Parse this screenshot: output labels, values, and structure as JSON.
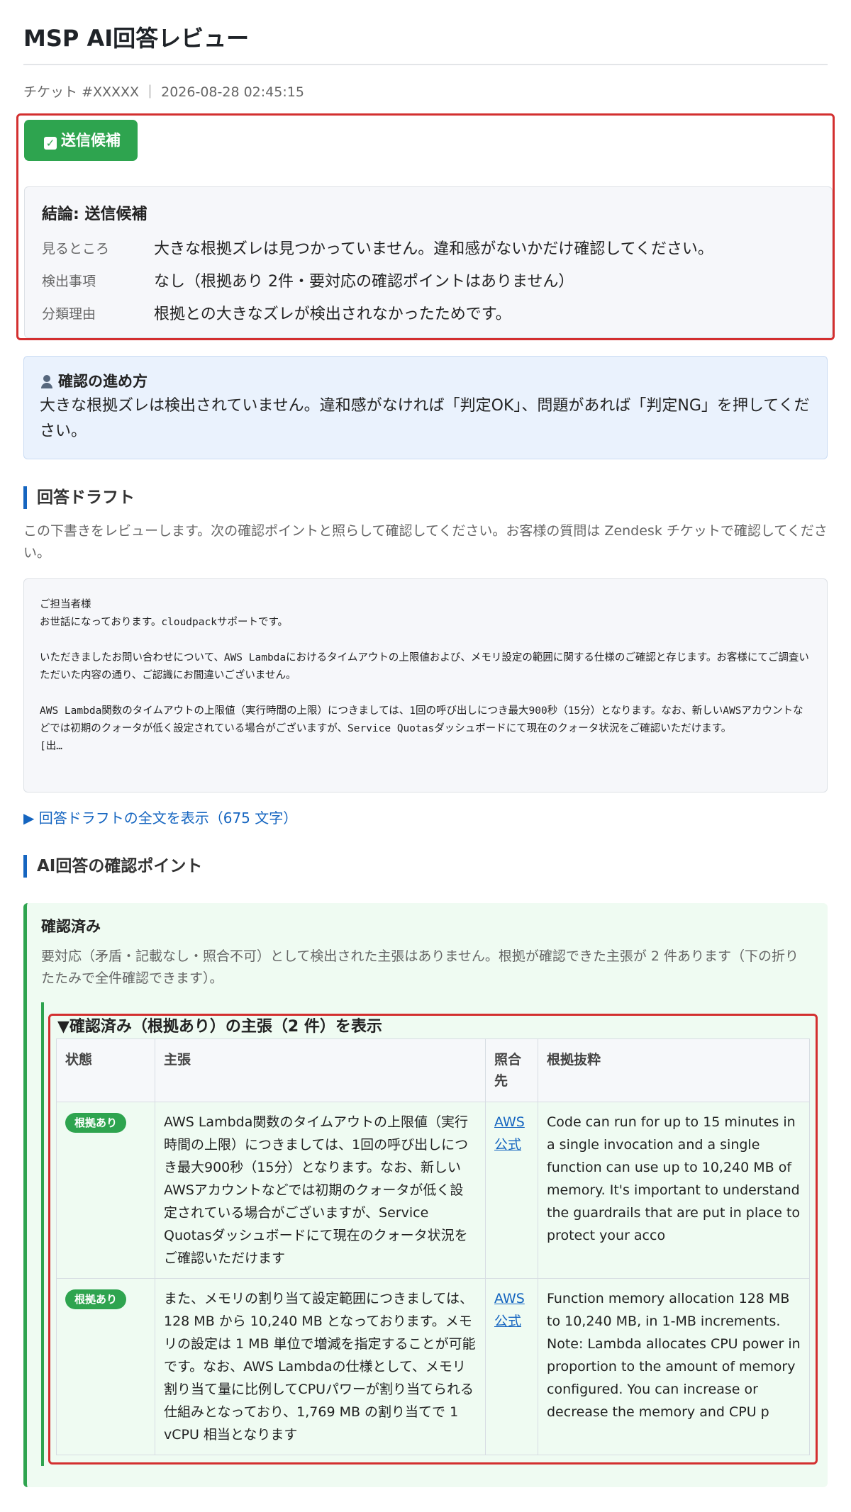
{
  "page": {
    "title": "MSP AI回答レビュー",
    "meta": "チケット #XXXXX ｜ 2026-08-28 02:45:15"
  },
  "verdict": {
    "badge_label": "送信候補",
    "badge_icon": "check-box-icon",
    "conclusion": "結論: 送信候補",
    "rows": [
      {
        "key": "見るところ",
        "value": "大きな根拠ズレは見つかっていません。違和感がないかだけ確認してください。"
      },
      {
        "key": "検出事項",
        "value": "なし（根拠あり 2件・要対応の確認ポイントはありません）"
      },
      {
        "key": "分類理由",
        "value": "根拠との大きなズレが検出されなかったためです。"
      }
    ]
  },
  "guide": {
    "title": "確認の進め方",
    "text": "大きな根拠ズレは検出されていません。違和感がなければ「判定OK」、問題があれば「判定NG」を押してください。"
  },
  "draft": {
    "heading": "回答ドラフト",
    "description": "この下書きをレビューします。次の確認ポイントと照らして確認してください。お客様の質問は Zendesk チケットで確認してください。",
    "body": "ご担当者様\nお世話になっております。cloudpackサポートです。\n\nいただきましたお問い合わせについて、AWS Lambdaにおけるタイムアウトの上限値および、メモリ設定の範囲に関する仕様のご確認と存じます。お客様にてご調査いただいた内容の通り、ご認識にお間違いございません。\n\nAWS Lambda関数のタイムアウトの上限値（実行時間の上限）につきましては、1回の呼び出しにつき最大900秒（15分）となります。なお、新しいAWSアカウントなどでは初期のクォータが低く設定されている場合がございますが、Service Quotasダッシュボードにて現在のクォータ状況をご確認いただけます。\n[出…",
    "expand_label": "▶ 回答ドラフトの全文を表示（675 文字）"
  },
  "checkpoints": {
    "heading": "AI回答の確認ポイント",
    "box_title": "確認済み",
    "box_desc": "要対応（矛盾・記載なし・照合不可）として検出された主張はありません。根拠が確認できた主張が 2 件あります（下の折りたたみで全件確認できます）。",
    "summary": "▼確認済み（根拠あり）の主張（2 件）を表示",
    "columns": [
      "状態",
      "主張",
      "照合先",
      "根拠抜粋"
    ],
    "rows": [
      {
        "status": "根拠あり",
        "claim": "AWS Lambda関数のタイムアウトの上限値（実行時間の上限）につきましては、1回の呼び出しにつき最大900秒（15分）となります。なお、新しいAWSアカウントなどでは初期のクォータが低く設定されている場合がございますが、Service Quotasダッシュボードにて現在のクォータ状況をご確認いただけます",
        "source": "AWS公式",
        "evidence": "Code can run for up to 15 minutes in a single invocation and a single function can use up to 10,240 MB of memory. It's important to understand the guardrails that are put in place to protect your acco"
      },
      {
        "status": "根拠あり",
        "claim": "また、メモリの割り当て設定範囲につきましては、128 MB から 10,240 MB となっております。メモリの設定は 1 MB 単位で増減を指定することが可能です。なお、AWS Lambdaの仕様として、メモリ割り当て量に比例してCPUパワーが割り当てられる仕組みとなっており、1,769 MB の割り当てで 1 vCPU 相当となります",
        "source": "AWS公式",
        "evidence": "Function memory allocation 128 MB to 10,240 MB, in 1-MB increments. Note: Lambda allocates CPU power in proportion to the amount of memory configured. You can increase or decrease the memory and CPU p"
      }
    ]
  }
}
